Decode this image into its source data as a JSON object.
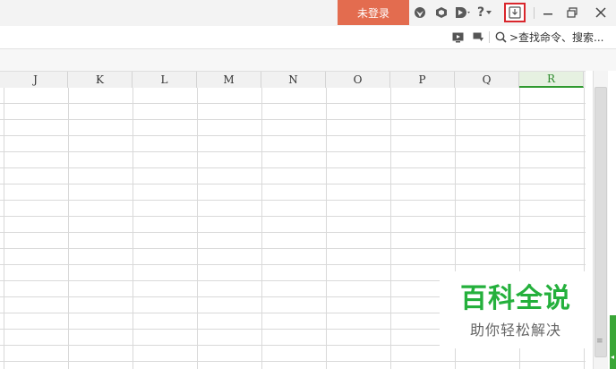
{
  "titlebar": {
    "login_label": "未登录",
    "accent_color": "#e36c4f",
    "icons": [
      "skin-icon",
      "cube-icon",
      "share-icon",
      "help-icon",
      "download-icon",
      "minimize-icon",
      "restore-icon",
      "close-icon"
    ],
    "help_glyph": "?",
    "download_highlight_color": "#d9262c"
  },
  "toolbar2": {
    "search_text": ">查找命令、搜索..."
  },
  "sheet": {
    "columns": [
      "J",
      "K",
      "L",
      "M",
      "N",
      "O",
      "P",
      "Q",
      "R"
    ],
    "selected_column": "R",
    "selected_color": "#2f9a2f"
  },
  "watermark": {
    "title": "百科全说",
    "subtitle": "助你轻松解决",
    "title_color": "#24b03c"
  }
}
